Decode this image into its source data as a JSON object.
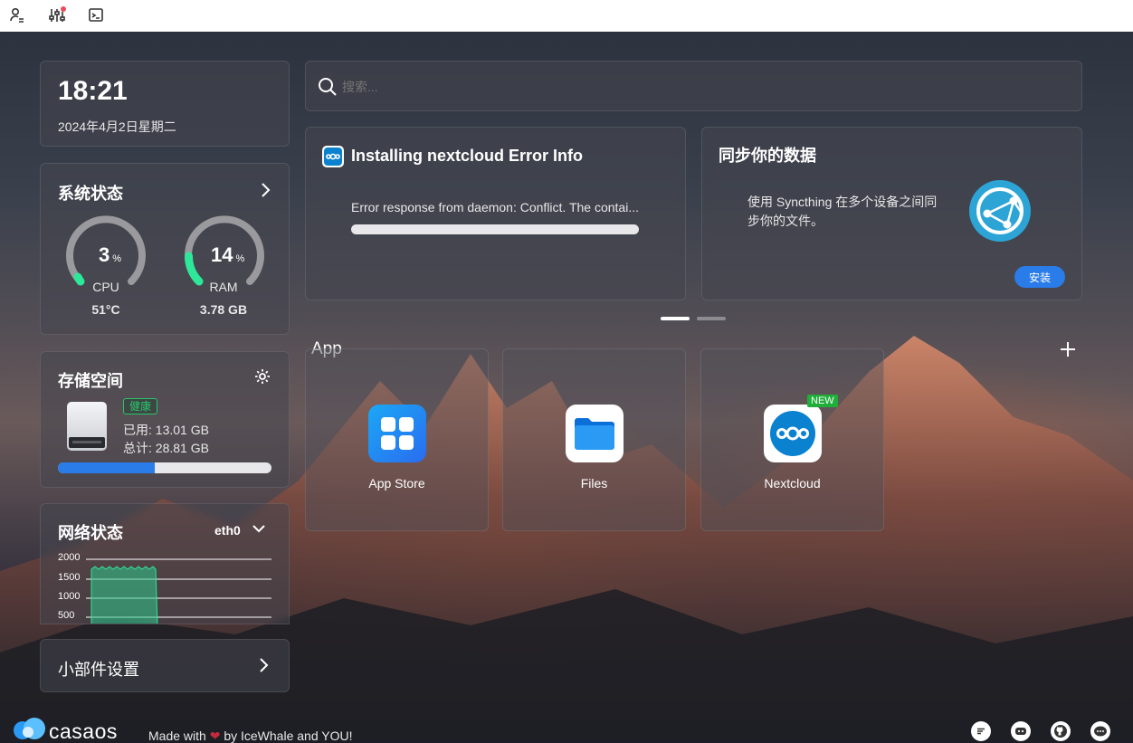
{
  "topbar": {
    "icons": [
      "user-settings-icon",
      "sliders-icon",
      "terminal-icon"
    ],
    "notification_dot_color": "#ef4a5a"
  },
  "clock": {
    "time": "18:21",
    "date": "2024年4月2日星期二"
  },
  "system_status": {
    "title": "系统状态",
    "cpu": {
      "value": "3",
      "unit": "%",
      "label": "CPU",
      "detail": "51°C",
      "percent": 3
    },
    "ram": {
      "value": "14",
      "unit": "%",
      "label": "RAM",
      "detail": "3.78 GB",
      "percent": 14
    }
  },
  "storage": {
    "title": "存储空间",
    "health": "健康",
    "used": "已用: 13.01 GB",
    "total": "总计: 28.81 GB",
    "used_fraction": 0.4516
  },
  "network": {
    "title": "网络状态",
    "interface": "eth0",
    "y_ticks": [
      "2000",
      "1500",
      "1000",
      "500"
    ]
  },
  "widget_settings": {
    "label": "小部件设置"
  },
  "search": {
    "placeholder": "搜索..."
  },
  "install_card": {
    "title": "Installing nextcloud Error Info",
    "message": "Error response from daemon: Conflict. The contai...",
    "progress": 1.0
  },
  "sync_card": {
    "title": "同步你的数据",
    "desc_line1": "使用 Syncthing 在多个设备之间同",
    "desc_line2": "步你的文件。",
    "install_label": "安装"
  },
  "apps_section": {
    "title": "App"
  },
  "apps": [
    {
      "name": "App Store",
      "icon": "app-store-icon",
      "badge": ""
    },
    {
      "name": "Files",
      "icon": "files-folder-icon",
      "badge": ""
    },
    {
      "name": "Nextcloud",
      "icon": "nextcloud-icon",
      "badge": "NEW"
    }
  ],
  "footer": {
    "brand": "casaos",
    "made_with_prefix": "Made with",
    "made_with_suffix": "by IceWhale and YOU!",
    "icons": [
      "message-icon",
      "discord-icon",
      "github-icon",
      "chat-bubble-icon"
    ]
  },
  "colors": {
    "accent_blue": "#2a7ce9",
    "gauge_green": "#2ee89a",
    "health_green": "#29c56a",
    "new_badge": "#1fae3a",
    "heart": "#c42a3c"
  }
}
